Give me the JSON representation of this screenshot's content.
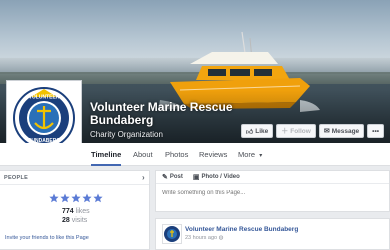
{
  "page": {
    "name_line1": "Volunteer Marine Rescue",
    "name_line2": "Bundaberg",
    "category": "Charity Organization",
    "logo_top_text": "VOLUNTEER",
    "logo_bottom_text": "BUNDABERG"
  },
  "actions": {
    "like": "Like",
    "follow": "Follow",
    "message": "Message",
    "more": "•••"
  },
  "tabs": [
    "Timeline",
    "About",
    "Photos",
    "Reviews",
    "More"
  ],
  "more_chevron": "▾",
  "people": {
    "heading": "PEOPLE",
    "rating_stars": 5,
    "likes_count": "774",
    "likes_label": "likes",
    "visits_count": "28",
    "visits_label": "visits",
    "invite_text": "Invite your friends to like this Page"
  },
  "composer": {
    "post_tab": "Post",
    "photo_tab": "Photo / Video",
    "placeholder": "Write something on this Page..."
  },
  "post": {
    "author": "Volunteer Marine Rescue Bundaberg",
    "time": "23 hours ago"
  },
  "colors": {
    "accent": "#4267b2",
    "link": "#365899",
    "star": "#5b7bd5",
    "boat": "#f2a50f"
  }
}
